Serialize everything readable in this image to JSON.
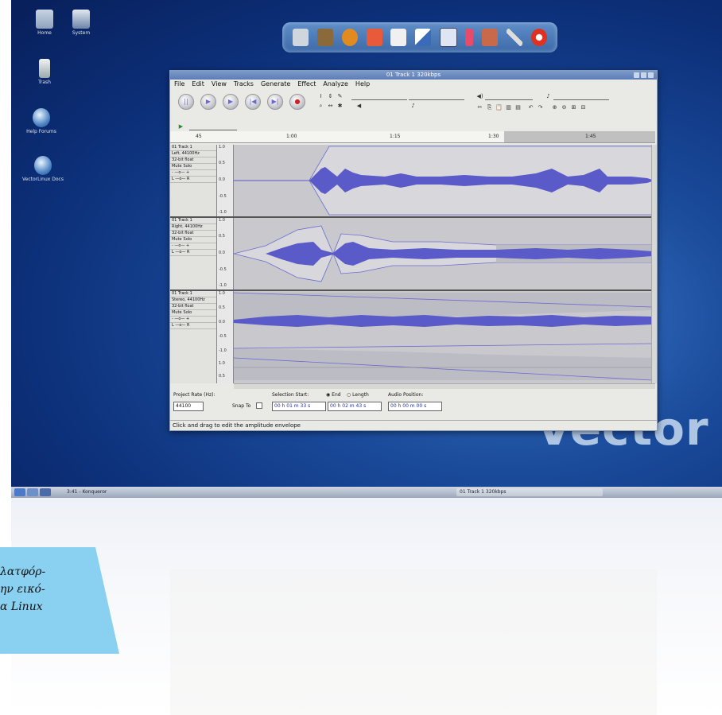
{
  "desktop": {
    "icons": [
      {
        "label": "Home",
        "icon": "home-folder-icon"
      },
      {
        "label": "System",
        "icon": "computer-icon"
      },
      {
        "label": "Trash",
        "icon": "trash-icon"
      },
      {
        "label": "Help Forums",
        "icon": "help-globe-icon"
      },
      {
        "label": "VectorLinux Docs",
        "icon": "docs-globe-icon"
      }
    ],
    "wallpaper_text": "Vector Lin",
    "dock_items": [
      "terminal-icon",
      "settings-icon",
      "fox-icon",
      "network-icon",
      "editor-icon",
      "paint-icon",
      "monitor-icon",
      "battery-icon",
      "mail-icon",
      "tools-icon",
      "power-icon"
    ]
  },
  "window": {
    "title": "01 Track 1 320kbps",
    "menu": [
      "File",
      "Edit",
      "View",
      "Tracks",
      "Generate",
      "Effect",
      "Analyze",
      "Help"
    ],
    "transport": [
      {
        "name": "pause-button",
        "glyph": "||"
      },
      {
        "name": "play-button",
        "glyph": "▶"
      },
      {
        "name": "loop-button",
        "glyph": "▶"
      },
      {
        "name": "skip-start-button",
        "glyph": "|◀"
      },
      {
        "name": "skip-end-button",
        "glyph": "▶|"
      },
      {
        "name": "record-button",
        "glyph": "●"
      }
    ],
    "ruler_labels": [
      "45",
      "1:00",
      "1:15",
      "1:30",
      "1:45"
    ],
    "tracks": [
      {
        "name": "01 Track 1",
        "format": "Left, 44100Hz",
        "bits": "32-bit float",
        "mute": "Mute",
        "solo": "Solo",
        "scale": [
          "1.0",
          "0.5",
          "0.0",
          "-0.5",
          "-1.0"
        ]
      },
      {
        "name": "01 Track 1",
        "format": "Right, 44100Hz",
        "bits": "32-bit float",
        "mute": "Mute",
        "solo": "Solo",
        "scale": [
          "1.0",
          "0.5",
          "0.0",
          "-0.5",
          "-1.0"
        ]
      },
      {
        "name": "01 Track 1",
        "format": "Stereo, 44100Hz",
        "bits": "32-bit float",
        "mute": "Mute",
        "solo": "Solo",
        "scale": [
          "1.0",
          "0.5",
          "0.0",
          "-0.5",
          "-1.0",
          "1.0",
          "0.5"
        ]
      }
    ],
    "selection_bar": {
      "project_rate_label": "Project Rate (Hz):",
      "project_rate_value": "44100",
      "snap_label": "Snap To",
      "selection_start_label": "Selection Start:",
      "end_label": "End",
      "length_label": "Length",
      "audio_position_label": "Audio Position:",
      "start_value": "00 h 01 m 33 s",
      "end_value": "00 h 02 m 43 s",
      "position_value": "00 h 00 m 00 s"
    },
    "status": "Click and drag to edit the amplitude envelope"
  },
  "taskbar": {
    "items": [
      "3:41 - Konqueror",
      "01 Track 1 320kbps"
    ]
  },
  "caption": {
    "text": "λατφόρ-\nην εικό-\nα Linux"
  }
}
